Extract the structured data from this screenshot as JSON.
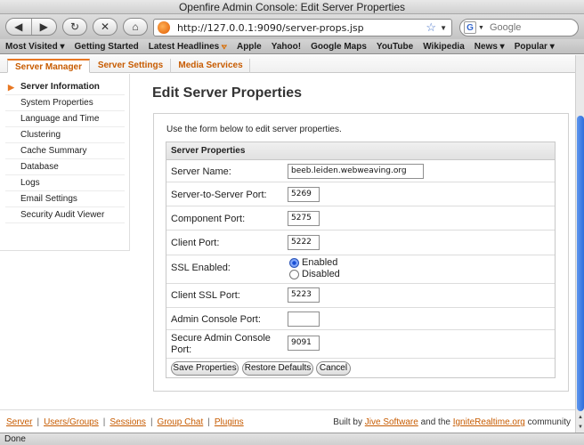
{
  "window": {
    "title": "Openfire Admin Console: Edit Server Properties"
  },
  "nav": {
    "back_icon": "back-arrow-icon",
    "forward_icon": "forward-arrow-icon",
    "reload_glyph": "↻",
    "stop_glyph": "✕",
    "home_glyph": "⌂",
    "back_glyph": "◀",
    "forward_glyph": "▶",
    "url": "http://127.0.0.1:9090/server-props.jsp",
    "star_glyph": "☆",
    "url_drop_glyph": "▼",
    "search_engine_glyph": "G",
    "search_drop_glyph": "▼",
    "search_placeholder": "Google"
  },
  "bookmarks": [
    {
      "label": "Most Visited ▾"
    },
    {
      "label": "Getting Started"
    },
    {
      "label": "Latest Headlines",
      "rss": "⦡"
    },
    {
      "label": "Apple"
    },
    {
      "label": "Yahoo!"
    },
    {
      "label": "Google Maps"
    },
    {
      "label": "YouTube"
    },
    {
      "label": "Wikipedia"
    },
    {
      "label": "News ▾"
    },
    {
      "label": "Popular ▾"
    }
  ],
  "tabs": {
    "server_manager": "Server Manager",
    "server_settings": "Server Settings",
    "media_services": "Media Services"
  },
  "sidebar": {
    "arrow": "▶",
    "items": [
      {
        "label": "Server Information"
      },
      {
        "label": "System Properties"
      },
      {
        "label": "Language and Time"
      },
      {
        "label": "Clustering"
      },
      {
        "label": "Cache Summary"
      },
      {
        "label": "Database"
      },
      {
        "label": "Logs"
      },
      {
        "label": "Email Settings"
      },
      {
        "label": "Security Audit Viewer"
      }
    ]
  },
  "main": {
    "title": "Edit Server Properties",
    "intro": "Use the form below to edit server properties.",
    "table_header": "Server Properties",
    "fields": {
      "server_name_label": "Server Name:",
      "server_name_value": "beeb.leiden.webweaving.org",
      "s2s_port_label": "Server-to-Server Port:",
      "s2s_port_value": "5269",
      "component_port_label": "Component Port:",
      "component_port_value": "5275",
      "client_port_label": "Client Port:",
      "client_port_value": "5222",
      "ssl_label": "SSL Enabled:",
      "ssl_enabled_label": "Enabled",
      "ssl_disabled_label": "Disabled",
      "client_ssl_port_label": "Client SSL Port:",
      "client_ssl_port_value": "5223",
      "admin_port_label": "Admin Console Port:",
      "admin_port_value": "",
      "secure_admin_port_label": "Secure Admin Console Port:",
      "secure_admin_port_value": "9091"
    },
    "buttons": {
      "save": "Save Properties",
      "restore": "Restore Defaults",
      "cancel": "Cancel"
    }
  },
  "footer": {
    "links": {
      "server": "Server",
      "users_groups": "Users/Groups",
      "sessions": "Sessions",
      "group_chat": "Group Chat",
      "plugins": "Plugins"
    },
    "sep": "|",
    "built_by": "Built by ",
    "jive": "Jive Software",
    "and_the": " and the ",
    "ignite": "IgniteRealtime.org",
    "community": " community"
  },
  "status": {
    "text": "Done"
  }
}
